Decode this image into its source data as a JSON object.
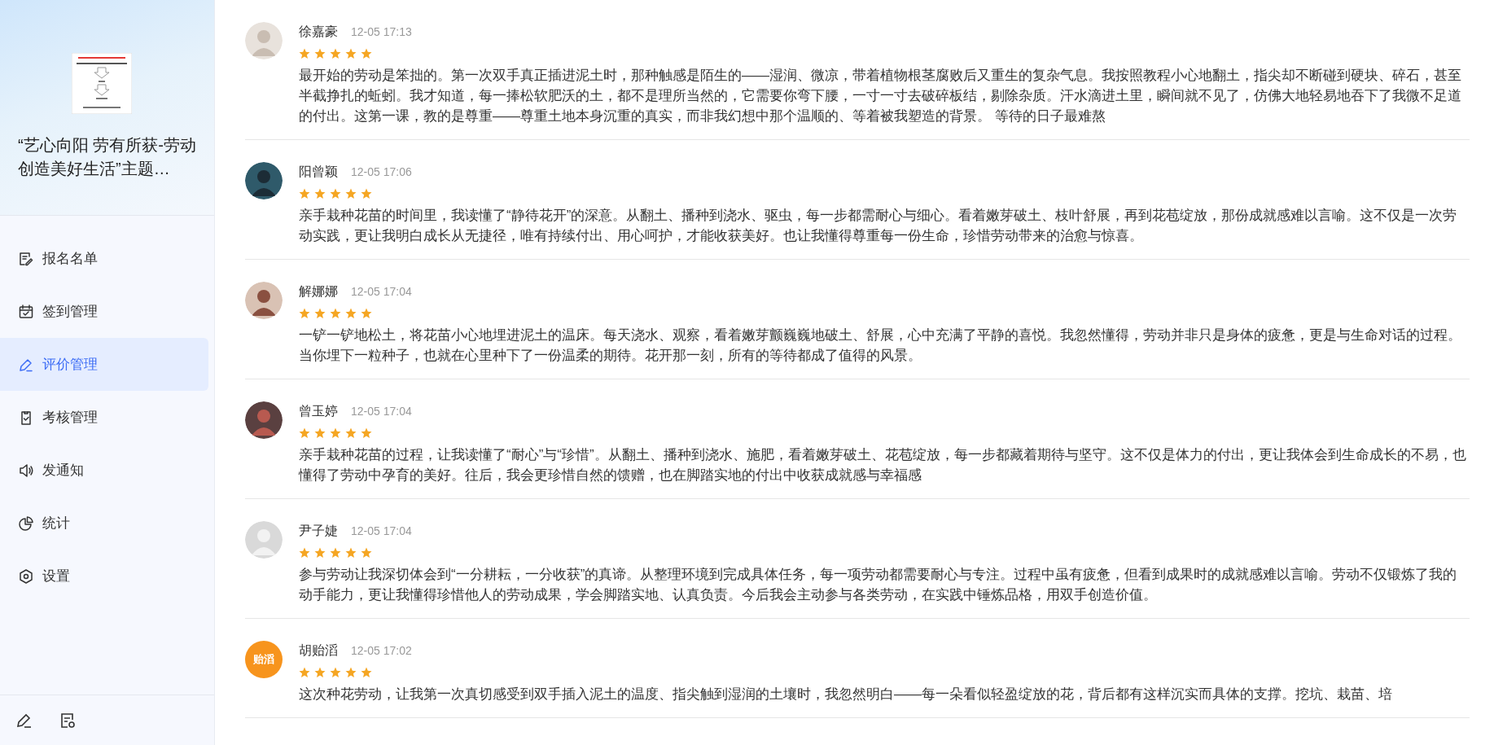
{
  "sidebar": {
    "title": "“艺心向阳 劳有所获-劳动创造美好生活”主题…",
    "items": [
      {
        "label": "报名名单",
        "selected": false
      },
      {
        "label": "签到管理",
        "selected": false
      },
      {
        "label": "评价管理",
        "selected": true
      },
      {
        "label": "考核管理",
        "selected": false
      },
      {
        "label": "发通知",
        "selected": false
      },
      {
        "label": "统计",
        "selected": false
      },
      {
        "label": "设置",
        "selected": false
      }
    ]
  },
  "comments": [
    {
      "name": "徐嘉豪",
      "time": "12-05 17:13",
      "stars": 5,
      "text": "最开始的劳动是笨拙的。第一次双手真正插进泥土时，那种触感是陌生的——湿润、微凉，带着植物根茎腐败后又重生的复杂气息。我按照教程小心地翻土，指尖却不断碰到硬块、碎石，甚至半截挣扎的蚯蚓。我才知道，每一捧松软肥沃的土，都不是理所当然的，它需要你弯下腰，一寸一寸去破碎板结，剔除杂质。汗水滴进土里，瞬间就不见了，仿佛大地轻易地吞下了我微不足道的付出。这第一课，教的是尊重——尊重土地本身沉重的真实，而非我幻想中那个温顺的、等着被我塑造的背景。 等待的日子最难熬"
    },
    {
      "name": "阳曾颖",
      "time": "12-05 17:06",
      "stars": 5,
      "text": "亲手栽种花苗的时间里，我读懂了“静待花开”的深意。从翻土、播种到浇水、驱虫，每一步都需耐心与细心。看着嫩芽破土、枝叶舒展，再到花苞绽放，那份成就感难以言喻。这不仅是一次劳动实践，更让我明白成长从无捷径，唯有持续付出、用心呵护，才能收获美好。也让我懂得尊重每一份生命，珍惜劳动带来的治愈与惊喜。"
    },
    {
      "name": "解娜娜",
      "time": "12-05 17:04",
      "stars": 5,
      "text": "一铲一铲地松土，将花苗小心地埋进泥土的温床。每天浇水、观察，看着嫩芽颤巍巍地破土、舒展，心中充满了平静的喜悦。我忽然懂得，劳动并非只是身体的疲惫，更是与生命对话的过程。当你埋下一粒种子，也就在心里种下了一份温柔的期待。花开那一刻，所有的等待都成了值得的风景。"
    },
    {
      "name": "曾玉婷",
      "time": "12-05 17:04",
      "stars": 5,
      "text": "亲手栽种花苗的过程，让我读懂了“耐心”与“珍惜”。从翻土、播种到浇水、施肥，看着嫩芽破土、花苞绽放，每一步都藏着期待与坚守。这不仅是体力的付出，更让我体会到生命成长的不易，也懂得了劳动中孕育的美好。往后，我会更珍惜自然的馈赠，也在脚踏实地的付出中收获成就感与幸福感"
    },
    {
      "name": "尹子婕",
      "time": "12-05 17:04",
      "stars": 5,
      "avatar": {
        "kind": "placeholder"
      },
      "text": "参与劳动让我深切体会到“一分耕耘，一分收获”的真谛。从整理环境到完成具体任务，每一项劳动都需要耐心与专注。过程中虽有疲惫，但看到成果时的成就感难以言喻。劳动不仅锻炼了我的动手能力，更让我懂得珍惜他人的劳动成果，学会脚踏实地、认真负责。今后我会主动参与各类劳动，在实践中锤炼品格，用双手创造价值。"
    },
    {
      "name": "胡贻滔",
      "time": "12-05 17:02",
      "stars": 5,
      "avatar": {
        "kind": "text",
        "label": "贻滔"
      },
      "text": "这次种花劳动，让我第一次真切感受到双手插入泥土的温度、指尖触到湿润的土壤时，我忽然明白——每一朵看似轻盈绽放的花，背后都有这样沉实而具体的支撑。挖坑、栽苗、培"
    }
  ]
}
